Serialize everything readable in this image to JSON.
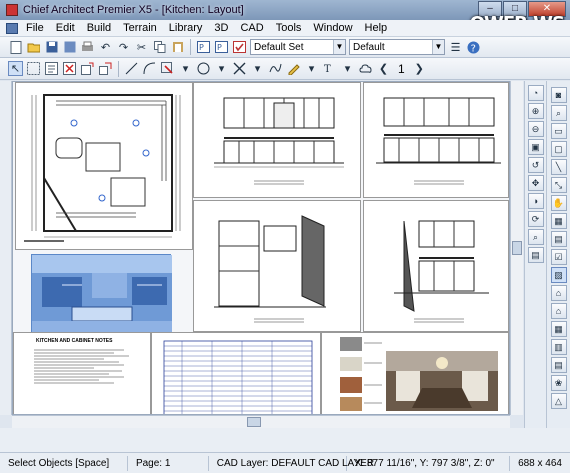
{
  "window": {
    "title": "Chief Architect Premier X5 - [Kitchen: Layout]",
    "minimize": "–",
    "maximize": "□",
    "close": "✕"
  },
  "watermark": "OWER.WS",
  "menu": [
    "File",
    "Edit",
    "Build",
    "Terrain",
    "Library",
    "3D",
    "CAD",
    "Tools",
    "Window",
    "Help"
  ],
  "toolbar": {
    "layer_set": "Default Set",
    "layer": "Default",
    "page_number": "1",
    "prev": "❮",
    "next": "❯"
  },
  "sheets": {
    "notes_title": "KITCHEN AND CABINET NOTES"
  },
  "status": {
    "mode": "Select Objects [Space]",
    "page": "Page: 1",
    "cad_layer": "CAD Layer:  DEFAULT CAD LAYER",
    "coords": "X: 877 11/16\", Y: 797 3/8\", Z: 0\"",
    "size": "688 x 464"
  }
}
